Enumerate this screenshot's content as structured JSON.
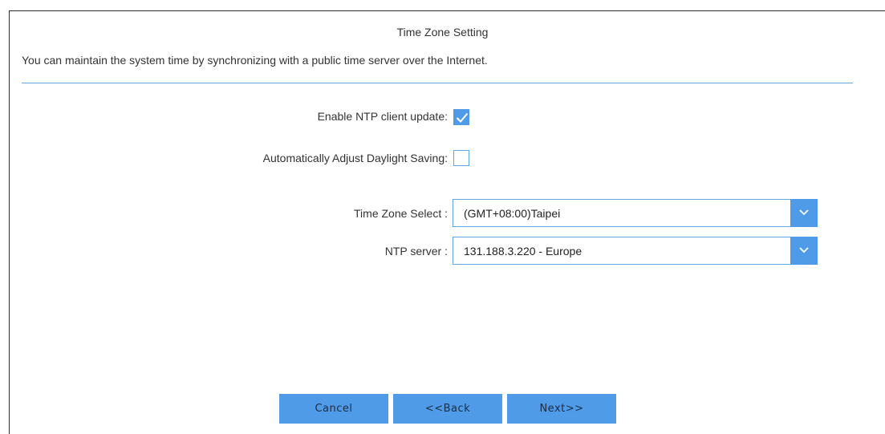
{
  "header": {
    "title": "Time Zone Setting",
    "description": "You can maintain the system time by synchronizing with a public time server over the Internet."
  },
  "form": {
    "ntp_client": {
      "label": "Enable NTP client update:",
      "checked": true
    },
    "daylight_saving": {
      "label": "Automatically Adjust Daylight Saving:",
      "checked": false
    },
    "time_zone": {
      "label": "Time Zone Select :",
      "value": "(GMT+08:00)Taipei"
    },
    "ntp_server": {
      "label": "NTP server :",
      "value": "131.188.3.220 - Europe"
    }
  },
  "buttons": {
    "cancel": "Cancel",
    "back": "<<Back",
    "next": "Next>>"
  },
  "colors": {
    "accent": "#4f9be8",
    "divider": "#5fa6e6",
    "text": "#333333"
  },
  "icons": {
    "check": "checkmark-icon",
    "dropdown": "chevron-down-icon"
  }
}
